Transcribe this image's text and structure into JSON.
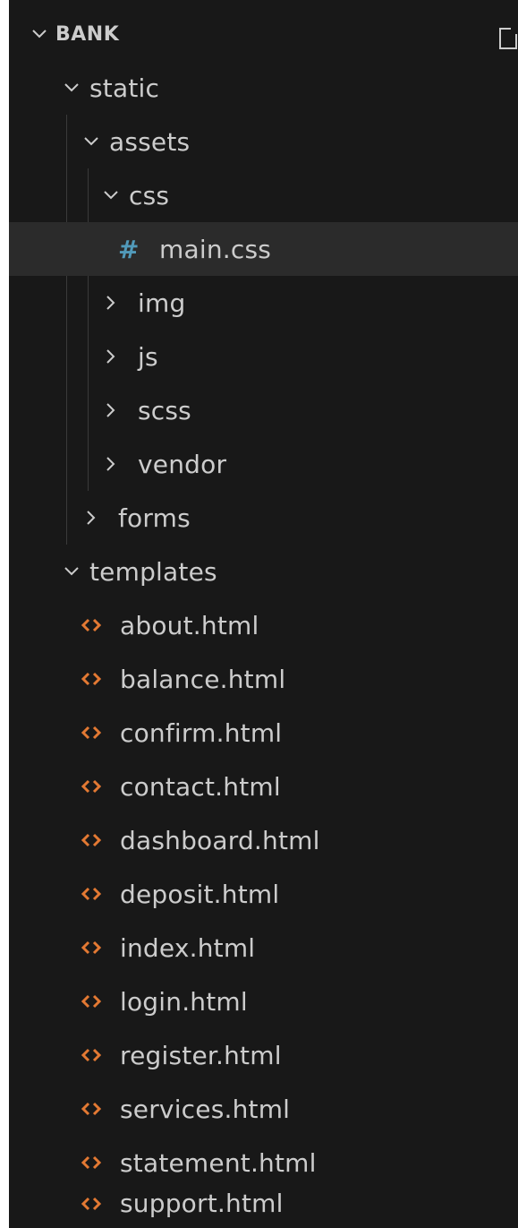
{
  "explorer": {
    "root_label": "BANK",
    "colors": {
      "background": "#181818",
      "text": "#cccccc",
      "selected_row": "#2b2b2b",
      "css_icon": "#519aba",
      "html_icon": "#e37933"
    },
    "tree": {
      "static": "static",
      "assets": "assets",
      "css": "css",
      "main_css": "main.css",
      "img": "img",
      "js": "js",
      "scss": "scss",
      "vendor": "vendor",
      "forms": "forms",
      "templates": "templates"
    },
    "templates_files": [
      "about.html",
      "balance.html",
      "confirm.html",
      "contact.html",
      "dashboard.html",
      "deposit.html",
      "index.html",
      "login.html",
      "register.html",
      "services.html",
      "statement.html",
      "support.html"
    ]
  }
}
